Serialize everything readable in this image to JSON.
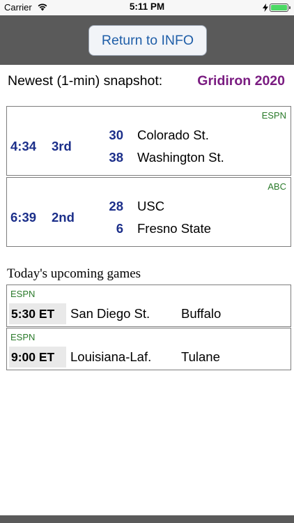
{
  "status_bar": {
    "carrier": "Carrier",
    "time": "5:11 PM",
    "battery_level": 1.0
  },
  "header": {
    "button_label": "Return to INFO"
  },
  "snapshot": {
    "label": "Newest (1-min) snapshot:",
    "season": "Gridiron 2020"
  },
  "live_games": [
    {
      "network": "ESPN",
      "clock": "4:34",
      "period": "3rd",
      "teams": [
        {
          "score": "30",
          "name": "Colorado St."
        },
        {
          "score": "38",
          "name": "Washington St."
        }
      ]
    },
    {
      "network": "ABC",
      "clock": "6:39",
      "period": "2nd",
      "teams": [
        {
          "score": "28",
          "name": "USC"
        },
        {
          "score": "6",
          "name": "Fresno State"
        }
      ]
    }
  ],
  "upcoming": {
    "heading": "Today's upcoming games",
    "games": [
      {
        "network": "ESPN",
        "time": "5:30 ET",
        "away": "San Diego St.",
        "home": "Buffalo"
      },
      {
        "network": "ESPN",
        "time": "9:00 ET",
        "away": "Louisiana-Laf.",
        "home": "Tulane"
      }
    ]
  },
  "colors": {
    "score": "#1c2f8a",
    "season": "#7a1c81",
    "network": "#2a7a2a",
    "header_bg": "#5a5a5a",
    "button_text": "#1f5ea8",
    "battery": "#4cd964"
  }
}
